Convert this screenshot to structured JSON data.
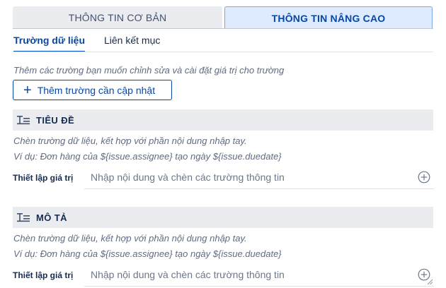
{
  "tabs": {
    "basic": "THÔNG TIN CƠ BẢN",
    "advanced": "THÔNG TIN NÂNG CAO"
  },
  "subtabs": {
    "fields": "Trường dữ liệu",
    "links": "Liên kết mục"
  },
  "intro": "Thêm các trường bạn muốn chỉnh sửa và cài đặt giá trị cho trường",
  "add_button": "Thêm trường cần cập nhật",
  "sections": [
    {
      "title": "TIÊU ĐỀ",
      "hint1": "Chèn trường dữ liệu, kết hợp với phần nội dung nhập tay.",
      "hint2": "Ví dụ: Đơn hàng của ${issue.assignee} tạo ngày ${issue.duedate}",
      "label": "Thiết lập giá trị",
      "placeholder": "Nhập nội dung và chèn các trường thông tin"
    },
    {
      "title": "MÔ TẢ",
      "hint1": "Chèn trường dữ liệu, kết hợp với phần nội dung nhập tay.",
      "hint2": "Ví dụ: Đơn hàng của ${issue.assignee} tạo ngày ${issue.duedate}",
      "label": "Thiết lập giá trị",
      "placeholder": "Nhập nội dung và chèn các trường thông tin"
    }
  ],
  "icons": {
    "add_field": "plus-icon",
    "section": "text-field-icon",
    "insert": "add-circle-icon"
  },
  "colors": {
    "accent": "#0747a6",
    "tab_active_bg": "#deebff",
    "section_bg": "#ebecf0"
  }
}
